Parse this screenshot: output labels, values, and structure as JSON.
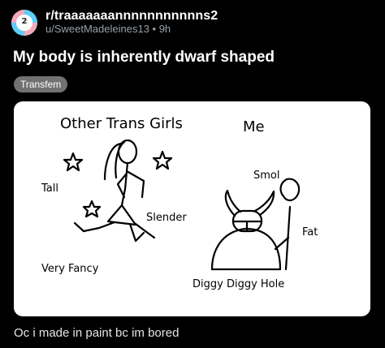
{
  "post": {
    "avatar_text": "2",
    "subreddit": "r/traaaaaaannnnnnnnnnns2",
    "user_line": "u/SweetMadeleines13 • 9h",
    "title": "My body is inherently dwarf shaped",
    "flair": "Transfem",
    "body": "Oc i made in paint bc im bored"
  },
  "drawing": {
    "heading_left": "Other Trans Girls",
    "heading_right": "Me",
    "label_tall": "Tall",
    "label_slender": "Slender",
    "label_very_fancy": "Very Fancy",
    "label_smol": "Smol",
    "label_fat": "Fat",
    "label_diggy": "Diggy Diggy Hole"
  },
  "colors": {
    "background": "#000000",
    "flair_bg": "#717171",
    "card_bg": "#ffffff"
  }
}
